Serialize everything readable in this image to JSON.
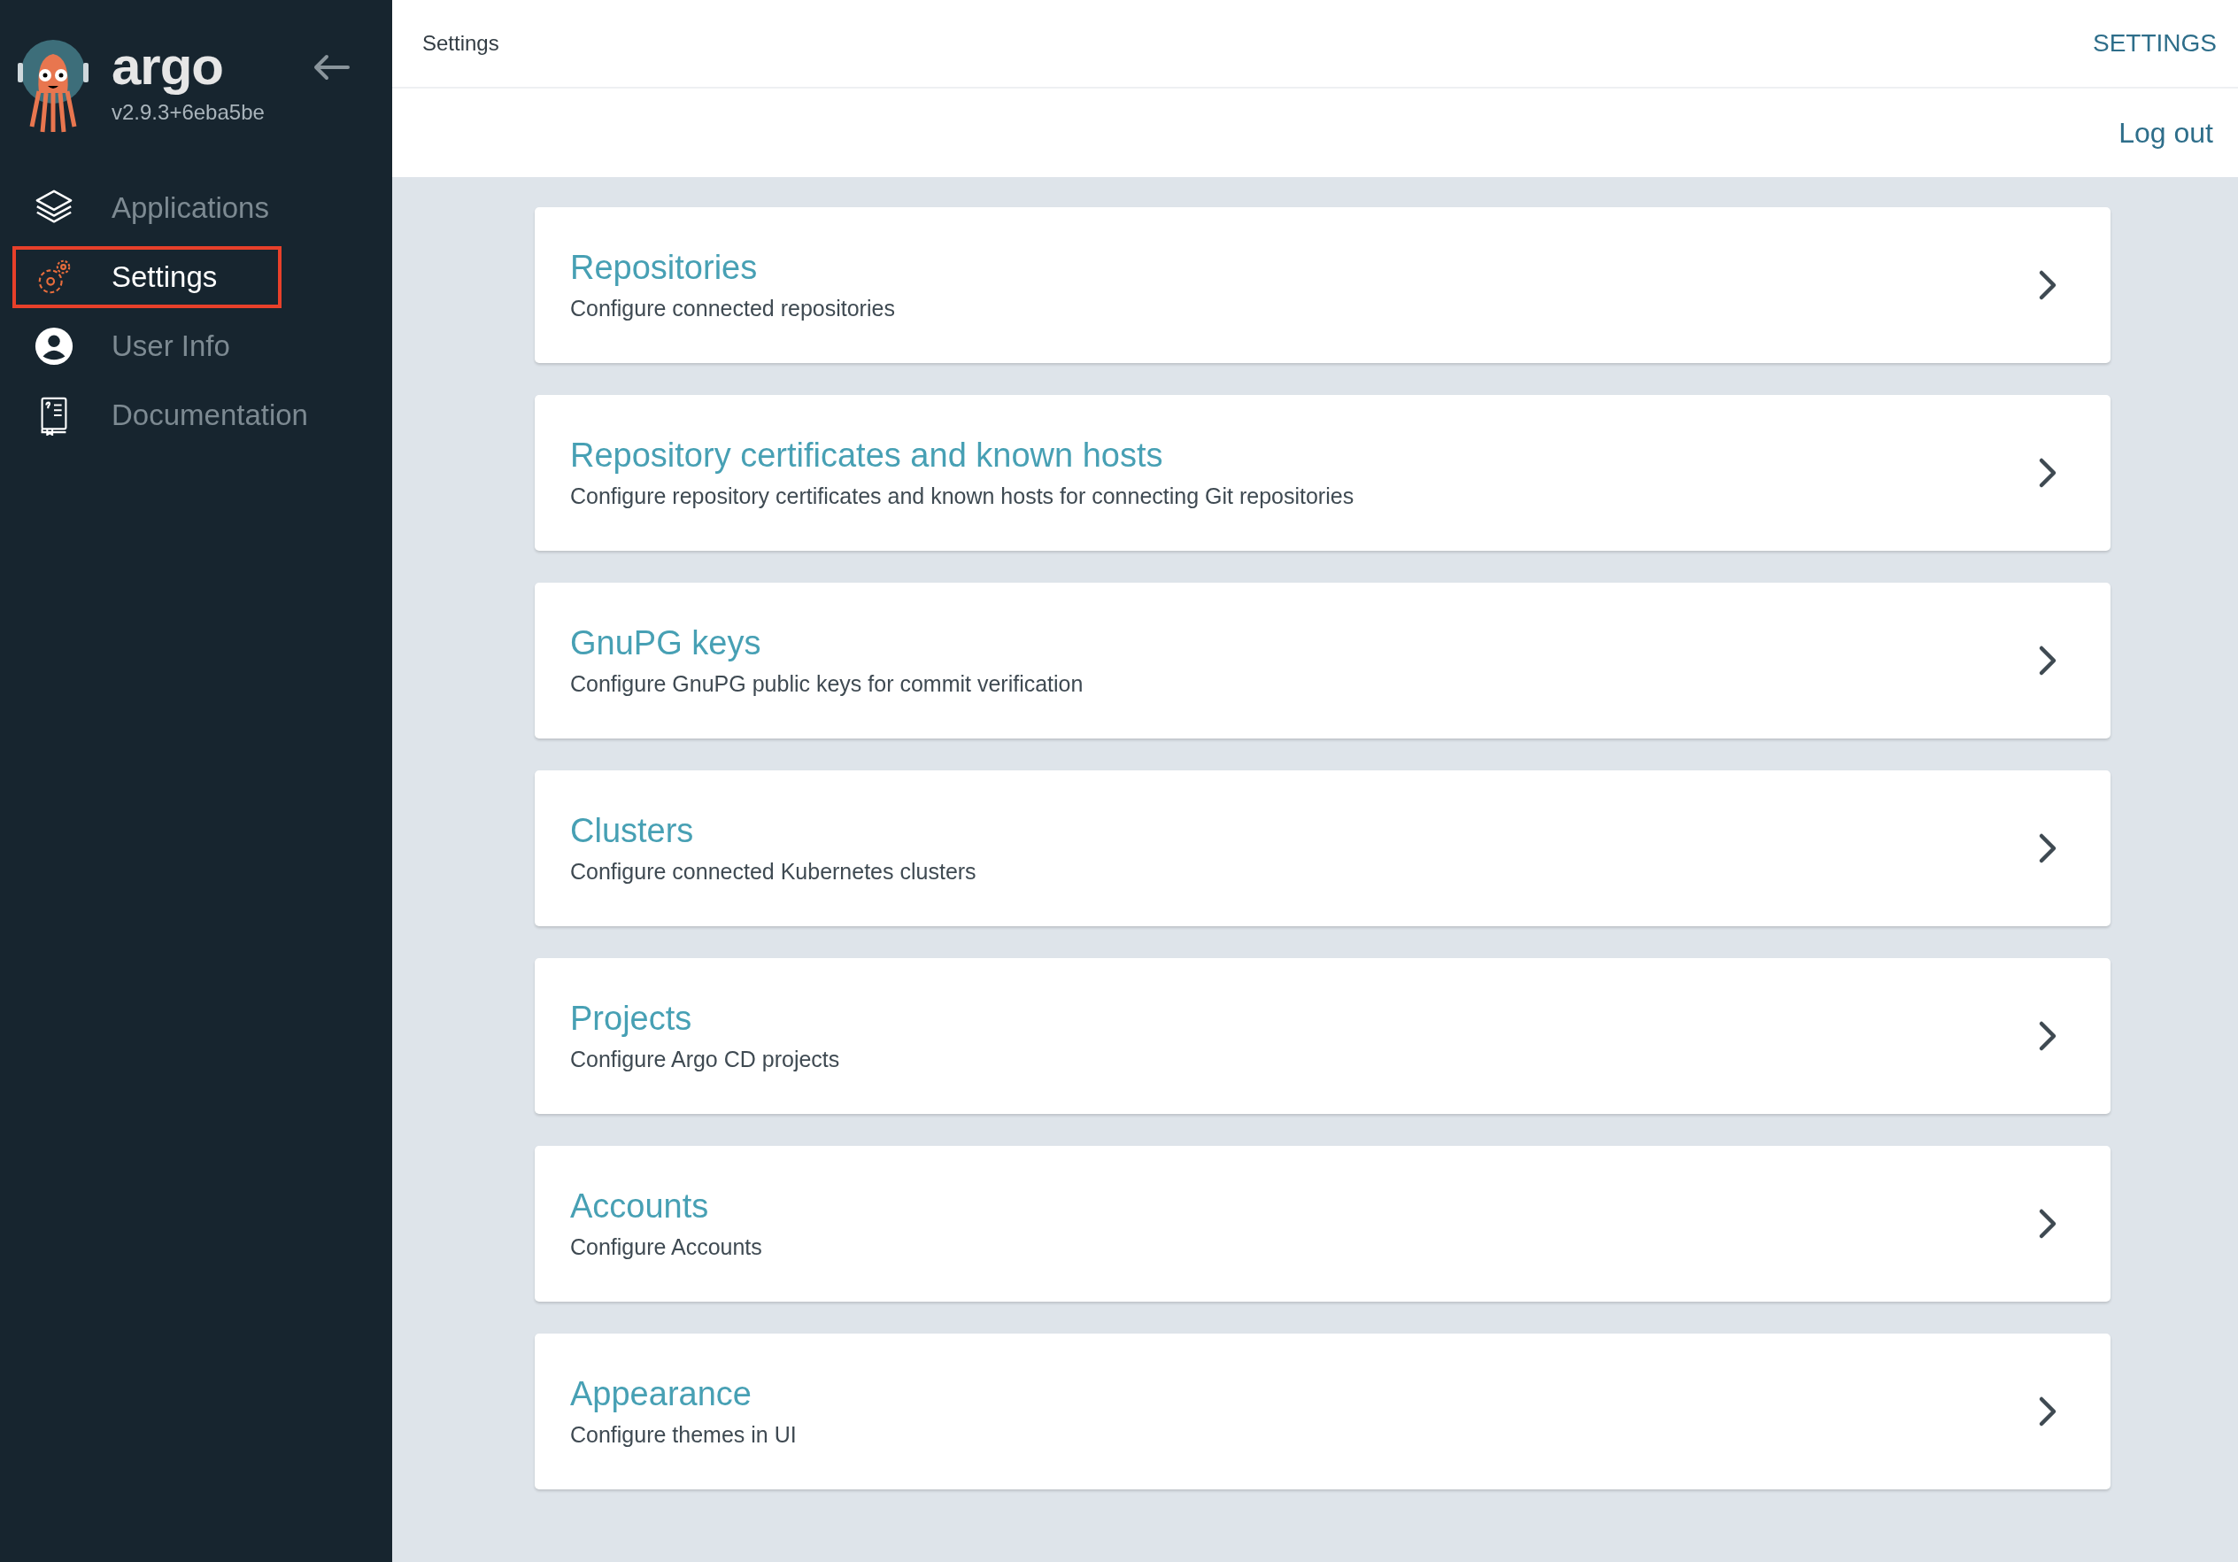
{
  "sidebar": {
    "brand": "argo",
    "version": "v2.9.3+6eba5be",
    "items": [
      {
        "label": "Applications",
        "selected": false
      },
      {
        "label": "Settings",
        "selected": true
      },
      {
        "label": "User Info",
        "selected": false
      },
      {
        "label": "Documentation",
        "selected": false
      }
    ]
  },
  "top_bar": {
    "breadcrumb": "Settings",
    "title": "SETTINGS"
  },
  "toolbar": {
    "logout": "Log out"
  },
  "cards": [
    {
      "title": "Repositories",
      "description": "Configure connected repositories"
    },
    {
      "title": "Repository certificates and known hosts",
      "description": "Configure repository certificates and known hosts for connecting Git repositories"
    },
    {
      "title": "GnuPG keys",
      "description": "Configure GnuPG public keys for commit verification"
    },
    {
      "title": "Clusters",
      "description": "Configure connected Kubernetes clusters"
    },
    {
      "title": "Projects",
      "description": "Configure Argo CD projects"
    },
    {
      "title": "Accounts",
      "description": "Configure Accounts"
    },
    {
      "title": "Appearance",
      "description": "Configure themes in UI"
    }
  ]
}
